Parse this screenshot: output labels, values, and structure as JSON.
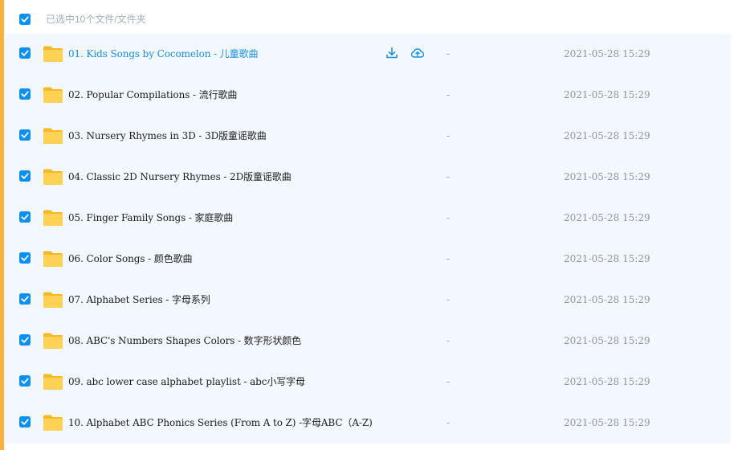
{
  "selection": {
    "text": "已选中10个文件/文件夹",
    "checked": true
  },
  "colors": {
    "accent": "#f8b13a",
    "checkbox": "#0a90f2",
    "link": "#1b8ed8",
    "row_bg": "#f2f8fe"
  },
  "files": [
    {
      "name": "01. Kids Songs by Cocomelon - 儿童歌曲",
      "size": "-",
      "date": "2021-05-28 15:29",
      "checked": true,
      "hover": true,
      "icon": "folder-icon"
    },
    {
      "name": "02. Popular Compilations - 流行歌曲",
      "size": "-",
      "date": "2021-05-28 15:29",
      "checked": true,
      "icon": "folder-icon"
    },
    {
      "name": "03. Nursery Rhymes in 3D - 3D版童谣歌曲",
      "size": "-",
      "date": "2021-05-28 15:29",
      "checked": true,
      "icon": "folder-icon"
    },
    {
      "name": "04. Classic 2D Nursery Rhymes - 2D版童谣歌曲",
      "size": "-",
      "date": "2021-05-28 15:29",
      "checked": true,
      "icon": "folder-icon"
    },
    {
      "name": "05. Finger Family Songs - 家庭歌曲",
      "size": "-",
      "date": "2021-05-28 15:29",
      "checked": true,
      "icon": "folder-icon"
    },
    {
      "name": "06. Color Songs - 颜色歌曲",
      "size": "-",
      "date": "2021-05-28 15:29",
      "checked": true,
      "icon": "folder-icon"
    },
    {
      "name": "07. Alphabet Series - 字母系列",
      "size": "-",
      "date": "2021-05-28 15:29",
      "checked": true,
      "icon": "folder-icon"
    },
    {
      "name": "08. ABC's Numbers Shapes Colors - 数字形状颜色",
      "size": "-",
      "date": "2021-05-28 15:29",
      "checked": true,
      "icon": "folder-icon"
    },
    {
      "name": "09. abc lower case alphabet playlist - abc小写字母",
      "size": "-",
      "date": "2021-05-28 15:29",
      "checked": true,
      "icon": "folder-icon"
    },
    {
      "name": "10. Alphabet ABC Phonics Series (From A to Z) -字母ABC（A-Z)",
      "size": "-",
      "date": "2021-05-28 15:29",
      "checked": true,
      "icon": "folder-icon"
    }
  ],
  "row_actions": [
    {
      "icon": "download-icon",
      "label": ""
    },
    {
      "icon": "cloud-save-icon",
      "label": ""
    }
  ]
}
